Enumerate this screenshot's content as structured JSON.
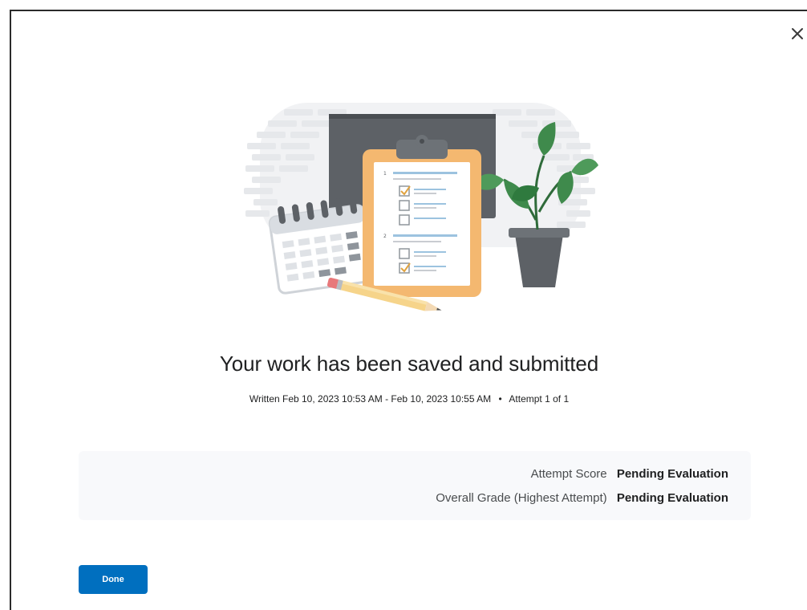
{
  "dialog": {
    "title": "Your work has been saved and submitted",
    "meta": {
      "written": "Written Feb 10, 2023 10:53 AM - Feb 10, 2023 10:55 AM",
      "separator": "•",
      "attempt": "Attempt 1 of 1"
    },
    "scores": [
      {
        "label": "Attempt Score",
        "value": "Pending Evaluation"
      },
      {
        "label": "Overall Grade (Highest Attempt)",
        "value": "Pending Evaluation"
      }
    ],
    "done_label": "Done",
    "close_icon": "close-icon",
    "illustration_icon": "clipboard-quiz-illustration",
    "accent_color": "#006fbf"
  }
}
